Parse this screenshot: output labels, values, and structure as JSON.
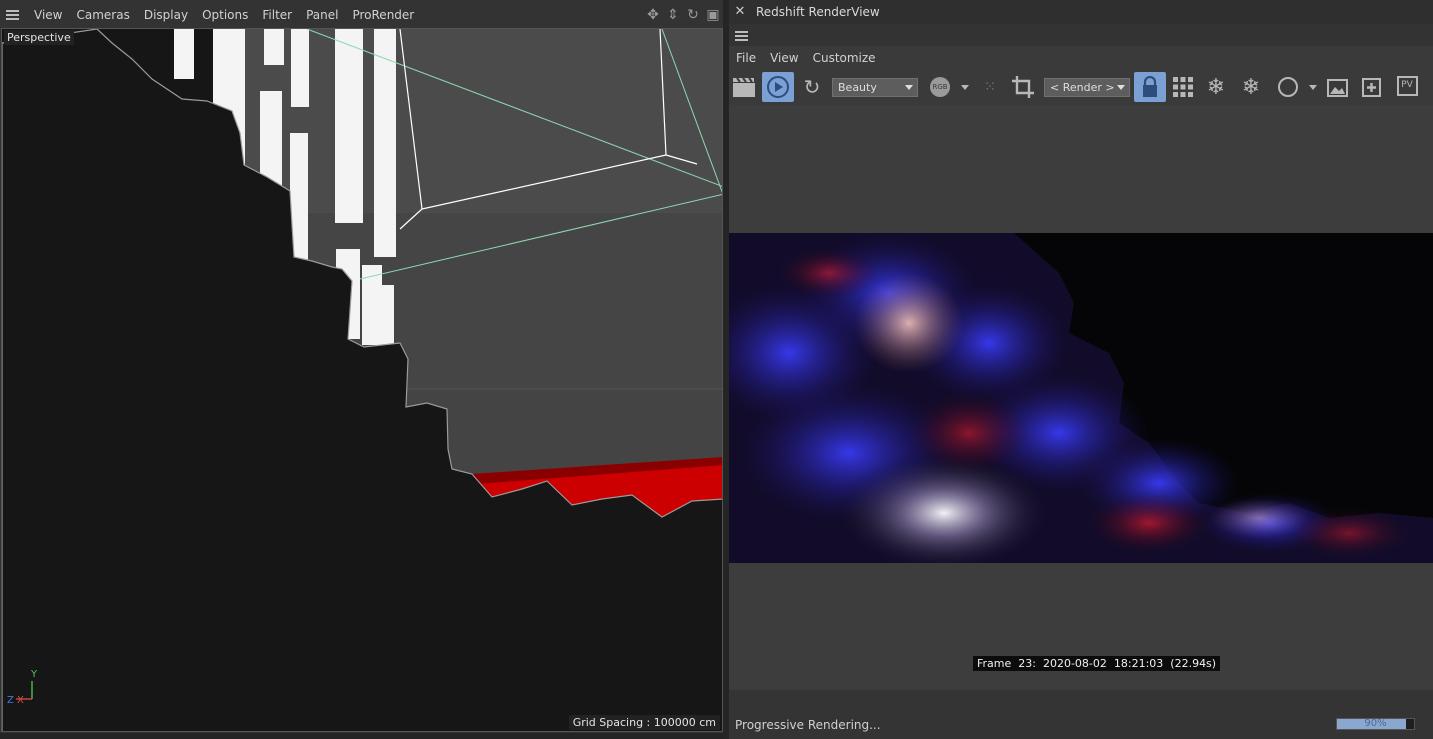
{
  "left_panel": {
    "menu": [
      "View",
      "Cameras",
      "Display",
      "Options",
      "Filter",
      "Panel",
      "ProRender"
    ],
    "nav_icons": [
      "move-icon",
      "dolly-icon",
      "rotate-icon",
      "maximize-icon"
    ],
    "viewport_label": "Perspective",
    "grid_spacing": "Grid Spacing : 100000 cm",
    "axes": {
      "y": "Y",
      "z": "Z",
      "x": "X"
    }
  },
  "render_view": {
    "title": "Redshift RenderView",
    "menu": [
      "File",
      "View",
      "Customize"
    ],
    "toolbar": {
      "aov_dropdown": "Beauty",
      "rgb_label": "RGB",
      "camera_dropdown": "< Render >",
      "pv_label": "PV"
    },
    "frame_info": "Frame  23:  2020-08-02  18:21:03  (22.94s)",
    "status": "Progressive Rendering...",
    "progress": {
      "value": 90,
      "label": "90%"
    },
    "overflow": "»"
  },
  "colors": {
    "accent": "#7aa0d4",
    "red_surface": "#c80a0a",
    "bbox_lines": "#8fd8b0"
  }
}
